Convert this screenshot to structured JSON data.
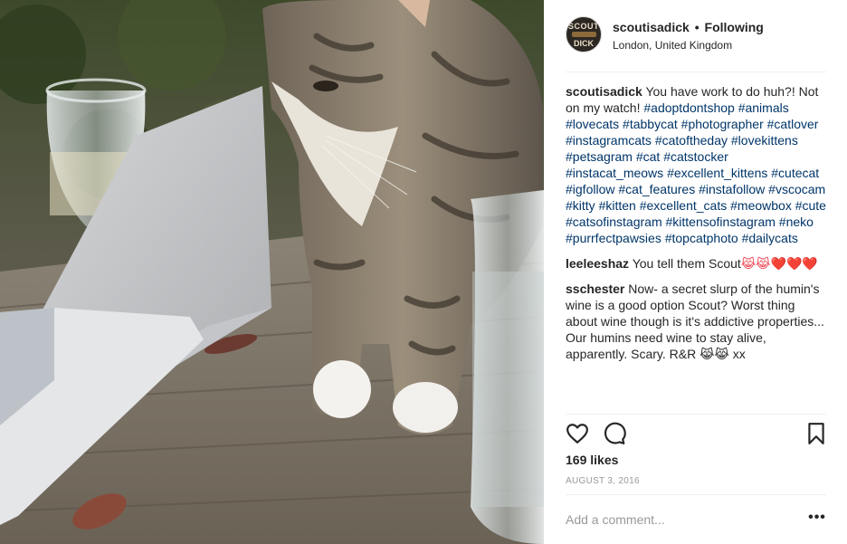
{
  "post": {
    "photo_alt": "Tabby cat standing on a wooden table next to an open laptop and wine glasses",
    "header": {
      "avatar_line1": "SCOUT",
      "avatar_line2": "DICK",
      "username": "scoutisadick",
      "separator": "•",
      "follow_status": "Following",
      "location": "London, United Kingdom"
    },
    "caption": {
      "username": "scoutisadick",
      "text_prefix": " You have work to do huh?! Not on my watch! ",
      "hashtags": [
        "#adoptdontshop",
        "#animals",
        "#lovecats",
        "#tabbycat",
        "#photographer",
        "#catlover",
        "#instagramcats",
        "#catoftheday",
        "#lovekittens",
        "#petsagram",
        "#cat",
        "#catstocker",
        "#instacat_meows",
        "#excellent_kittens",
        "#cutecat",
        "#igfollow",
        "#cat_features",
        "#instafollow",
        "#vscocam",
        "#kitty",
        "#kitten",
        "#excellent_cats",
        "#meowbox",
        "#cute",
        "#catsofinstagram",
        "#kittensofinstagram",
        "#neko",
        "#purrfectpawsies",
        "#topcatphoto",
        "#dailycats"
      ]
    },
    "comments": [
      {
        "username": "leeleeshaz",
        "text": " You tell them Scout",
        "emoji": "😹😹❤️❤️❤️"
      },
      {
        "username": "sschester",
        "text": " Now- a secret slurp of the humin's wine is a good option Scout? Worst thing about wine though is it's addictive properties... Our humins need wine to stay alive, apparently. Scary. R&R ",
        "emoji": "😹😹 xx"
      }
    ],
    "likes": "169 likes",
    "date": "AUGUST 3, 2016",
    "comment_placeholder": "Add a comment...",
    "more_label": "•••",
    "icons": {
      "like": "heart-outline-icon",
      "comment": "speech-bubble-icon",
      "save": "bookmark-icon",
      "more": "ellipsis-icon"
    },
    "colors": {
      "hashtag": "#003569",
      "secondary_text": "#999999",
      "divider": "#efefef",
      "heart": "#ed4956"
    }
  }
}
